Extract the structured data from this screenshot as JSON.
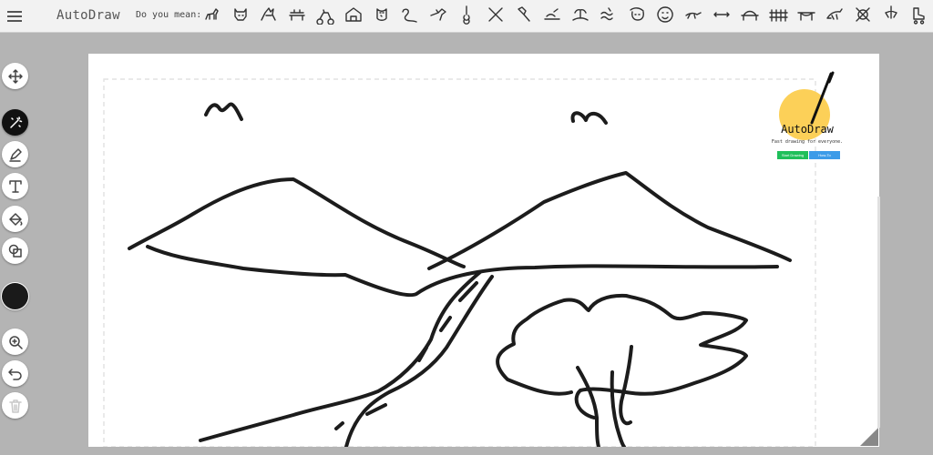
{
  "app": {
    "title": "AutoDraw"
  },
  "topbar": {
    "suggest_label": "Do you mean:",
    "suggestions": [
      "dog-icon",
      "cat-icon",
      "wolf-icon",
      "bench-icon",
      "bicycle-icon",
      "barn-icon",
      "owl-icon",
      "snake-icon",
      "hummingbird-icon",
      "guitar-icon",
      "swords-icon",
      "hammer-icon",
      "beach-icon",
      "island-icon",
      "waves-icon",
      "sloth-icon",
      "face-icon",
      "lizard-icon",
      "arrows-icon",
      "bridge-icon",
      "fence-icon",
      "bridge-arch-icon",
      "dragon-icon",
      "crossed-out-icon",
      "chandelier-icon",
      "roller-skate-icon"
    ]
  },
  "toolbar": {
    "tools": [
      {
        "name": "move-tool",
        "icon": "move-icon"
      },
      {
        "name": "autodraw-tool",
        "icon": "autodraw-wand-icon",
        "active": true
      },
      {
        "name": "draw-tool",
        "icon": "pencil-icon"
      },
      {
        "name": "type-tool",
        "icon": "text-icon"
      },
      {
        "name": "fill-tool",
        "icon": "fill-bucket-icon"
      },
      {
        "name": "shape-tool",
        "icon": "shapes-icon"
      },
      {
        "name": "color-tool",
        "icon": "color-swatch",
        "color": "#1a1a1a"
      },
      {
        "name": "zoom-tool",
        "icon": "zoom-icon"
      },
      {
        "name": "undo-tool",
        "icon": "undo-icon"
      },
      {
        "name": "delete-tool",
        "icon": "trash-icon",
        "disabled": true
      }
    ]
  },
  "splash": {
    "brand": "AutoDraw",
    "tagline": "Fast drawing for everyone.",
    "start_label": "Start Drawing",
    "how_label": "How-To",
    "sun_color": "#fcd058"
  },
  "colors": {
    "accent_start": "#1fbf5a",
    "accent_how": "#3c9be8",
    "canvas_bg": "#ffffff",
    "workspace_bg": "#b4b4b4"
  }
}
